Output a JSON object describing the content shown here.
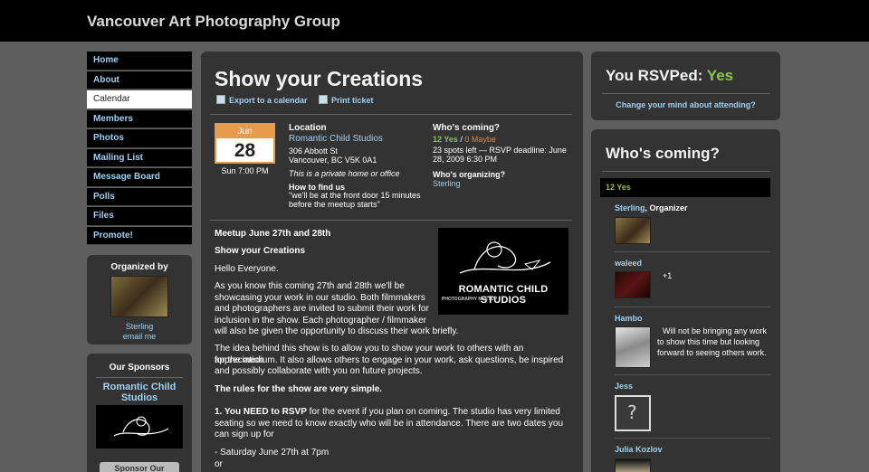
{
  "site": {
    "title": "Vancouver Art Photography Group"
  },
  "nav": {
    "items": [
      "Home",
      "About",
      "Calendar",
      "Members",
      "Photos",
      "Mailing List",
      "Message Board",
      "Polls",
      "Files",
      "Promote!"
    ]
  },
  "organized_by": {
    "title": "Organized by",
    "name": "Sterling",
    "email": "email me"
  },
  "sponsors": {
    "title": "Our Sponsors",
    "name": "Romantic Child Studios",
    "button": "Sponsor Our"
  },
  "event": {
    "title": "Show your Creations",
    "export_label": "Export to a calendar",
    "print_label": "Print ticket",
    "month": "Jun",
    "day": "28",
    "time": "Sun 7:00 PM",
    "location_label": "Location",
    "location_name": "Romantic Child Studios",
    "address1": "306 Abbott St",
    "address2": "Vancouver, BC V5K 0A1",
    "private_note": "This is a private home or office",
    "find_label": "How to find us",
    "find_text1": "\"we'll be at the front door 15 minutes",
    "find_text2": "before the meetup starts\"",
    "coming_label": "Who's coming?",
    "yes_count": "12 Yes",
    "maybe_count": "0 Maybe",
    "spots1": "23 spots left — RSVP deadline: June",
    "spots2": "28, 2009 6:30 PM",
    "organizing_label": "Who's organizing?",
    "organizer": "Sterling"
  },
  "description": {
    "p1": "Meetup June 27th and 28th",
    "p2": "Show your Creations",
    "p3": "Hello Everyone.",
    "p4a": "As you know this coming 27th and 28th we'll be",
    "p4b": "showcasing your work in our studio. Both filmmakers",
    "p4c": "and photographers are invited to submit their work for",
    "p4d": "inclusion in the show. Each photographer / filmmaker",
    "p4e": "will also be given the opportunity to discuss their work briefly.",
    "p5a": "The idea behind this show is to allow you to show your work to others with an appreciation",
    "p5b": "for the medium. It also allows others to engage in your work, ask questions, be inspired",
    "p5c": "and possibly collaborate with you on future projects.",
    "p6": "The rules for the show are very simple.",
    "p7_strong": "1. You NEED to RSVP",
    "p7a": " for the event if you plan on coming. The studio has very limited",
    "p7b": "seating so we need to know exactly who will be in attendance. There are two dates you",
    "p7c": "can sign up for",
    "p8": "- Saturday June 27th at 7pm",
    "p9": "or",
    "logo_text": "ROMANTIC CHILD STUDIOS",
    "logo_sub": "PHOTOGRAPHY MEETUP"
  },
  "rsvp": {
    "title_prefix": "You RSVPed:",
    "answer": "Yes",
    "change": "Change your mind about attending?"
  },
  "who": {
    "title": "Who's coming?",
    "bar": "12 Yes",
    "members": [
      {
        "name": "Sterling",
        "role": ", Organizer"
      },
      {
        "name": "waleed",
        "note": "+1"
      },
      {
        "name": "Hambo",
        "note1": "Will not be bringing any work",
        "note2": "to show this time but looking",
        "note3": "forward to seeing others work."
      },
      {
        "name": "Jess"
      },
      {
        "name": "Julia Kozlov"
      }
    ]
  },
  "colors": {
    "link": "#9fd0f2",
    "yes": "#8bc34a",
    "maybe": "#d9884a",
    "date": "#e69a4b"
  }
}
